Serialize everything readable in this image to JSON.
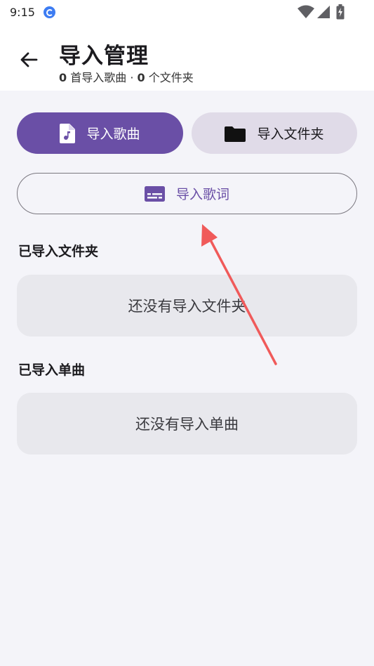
{
  "status_bar": {
    "time": "9:15",
    "icons": [
      "app-notification-icon",
      "wifi-icon",
      "signal-icon",
      "battery-charging-icon"
    ]
  },
  "header": {
    "title": "导入管理",
    "subtitle": {
      "song_count": "0",
      "song_unit": " 首导入歌曲 · ",
      "folder_count": "0",
      "folder_unit": " 个文件夹"
    },
    "back_icon": "arrow-back-icon"
  },
  "actions": {
    "import_songs": {
      "label": "导入歌曲",
      "icon": "music-file-icon"
    },
    "import_folder": {
      "label": "导入文件夹",
      "icon": "folder-icon"
    },
    "import_lyrics": {
      "label": "导入歌词",
      "icon": "subtitles-icon"
    }
  },
  "sections": {
    "folders": {
      "title": "已导入文件夹",
      "empty_text": "还没有导入文件夹"
    },
    "songs": {
      "title": "已导入单曲",
      "empty_text": "还没有导入单曲"
    }
  },
  "colors": {
    "primary": "#6a4fa6",
    "secondary_container": "#e0dbe8",
    "background": "#f4f4f9",
    "card": "#e8e8ed",
    "annotation_arrow": "#f05a5a"
  }
}
